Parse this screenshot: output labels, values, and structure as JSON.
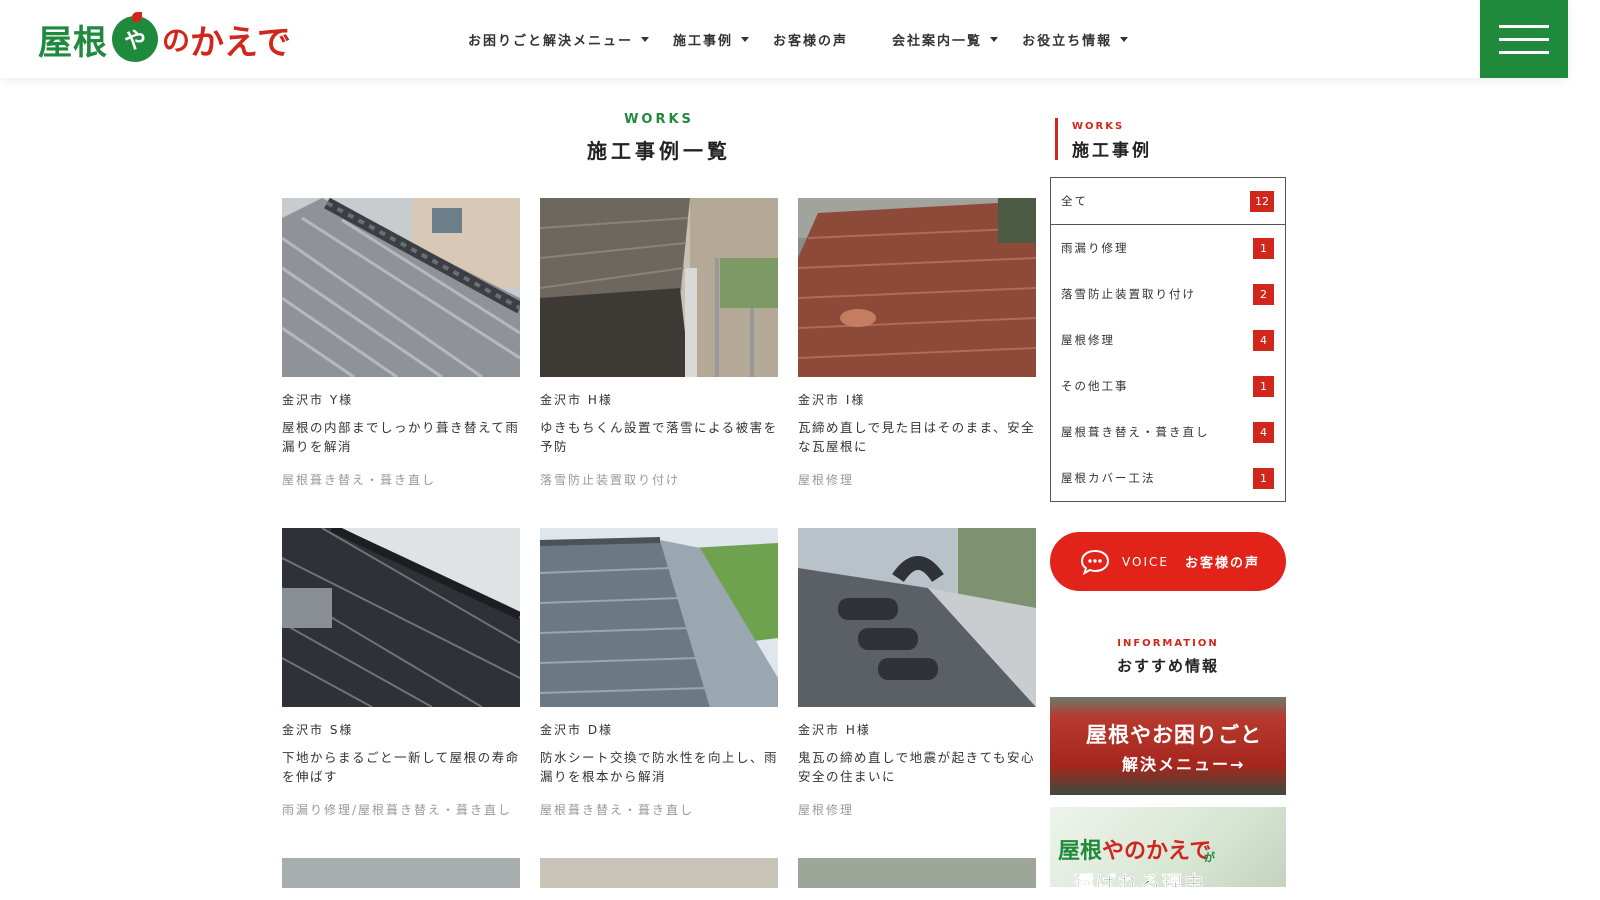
{
  "header": {
    "logo": {
      "part1": "屋根",
      "mark": "や",
      "part2": "の",
      "part3": "かえで"
    },
    "nav": [
      {
        "label": "お困りごと解決メニュー",
        "dropdown": true
      },
      {
        "label": "施工事例",
        "dropdown": true
      },
      {
        "label": "お客様の声",
        "dropdown": false
      },
      {
        "label": "会社案内一覧",
        "dropdown": true
      },
      {
        "label": "お役立ち情報",
        "dropdown": true
      }
    ]
  },
  "main": {
    "section_en": "WORKS",
    "section_jp": "施工事例一覧",
    "cards": [
      {
        "location": "金沢市 Y様",
        "title": "屋根の内部までしっかり葺き替えて雨漏りを解消",
        "category": "屋根葺き替え・葺き直し",
        "image": "gray-tile-roof-ridge"
      },
      {
        "location": "金沢市 H様",
        "title": "ゆきもちくん設置で落雪による被害を予防",
        "category": "落雪防止装置取り付け",
        "image": "wet-tile-roof-snow-guard"
      },
      {
        "location": "金沢市 I様",
        "title": "瓦締め直しで見た目はそのまま、安全な瓦屋根に",
        "category": "屋根修理",
        "image": "red-tile-roof"
      },
      {
        "location": "金沢市 S様",
        "title": "下地からまるごと一新して屋根の寿命を伸ばす",
        "category": "雨漏り修理/屋根葺き替え・葺き直し",
        "image": "black-tile-roof"
      },
      {
        "location": "金沢市 D様",
        "title": "防水シート交換で防水性を向上し、雨漏りを根本から解消",
        "category": "屋根葺き替え・葺き直し",
        "image": "blue-gray-tile-roof-field"
      },
      {
        "location": "金沢市 H様",
        "title": "鬼瓦の締め直しで地震が起きても安心安全の住まいに",
        "category": "屋根修理",
        "image": "ridge-closeup-roof"
      }
    ]
  },
  "sidebar": {
    "en": "WORKS",
    "jp": "施工事例",
    "categories": [
      {
        "label": "全て",
        "count": "12"
      },
      {
        "label": "雨漏り修理",
        "count": "1"
      },
      {
        "label": "落雪防止装置取り付け",
        "count": "2"
      },
      {
        "label": "屋根修理",
        "count": "4"
      },
      {
        "label": "その他工事",
        "count": "1"
      },
      {
        "label": "屋根葺き替え・葺き直し",
        "count": "4"
      },
      {
        "label": "屋根カバー工法",
        "count": "1"
      }
    ],
    "voice": {
      "en": "VOICE",
      "jp": "お客様の声"
    },
    "info_en": "INFORMATION",
    "info_jp": "おすすめ情報",
    "banner1": {
      "line1": "屋根やお困りごと",
      "line2": "解決メニュー→"
    },
    "banner2": {
      "logo_a": "屋根",
      "logo_b": "や",
      "logo_c": "のかえで",
      "ga": "が",
      "text": "選ばれる理由"
    }
  },
  "colors": {
    "green": "#1f8a3c",
    "red": "#d0261c",
    "voice_red": "#e2231a"
  }
}
